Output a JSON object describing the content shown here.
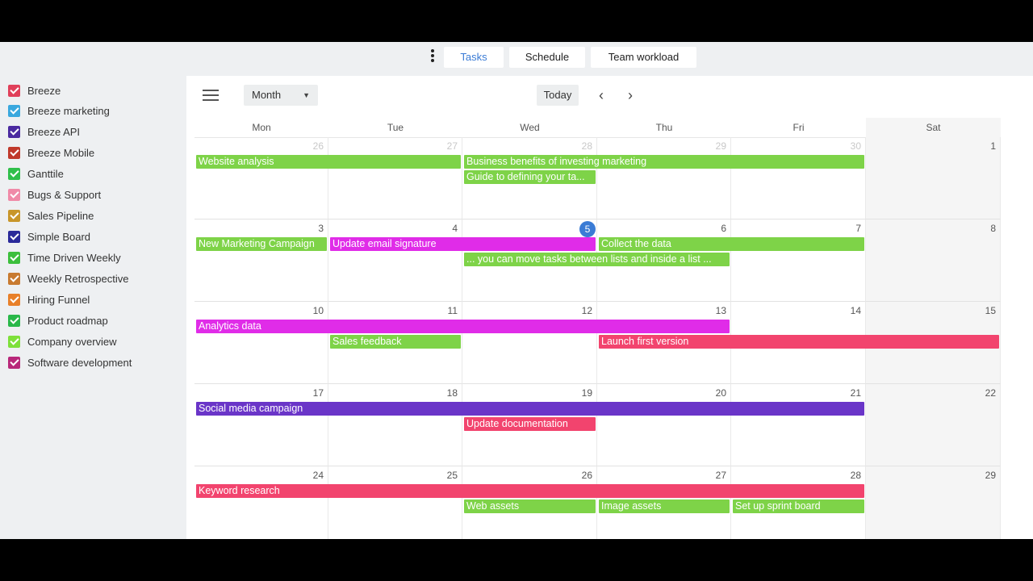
{
  "colors": {
    "green": "#7ed348",
    "magenta": "#e02ce8",
    "pink": "#f2446e",
    "purple": "#6a35c8",
    "accent": "#3a7bd5"
  },
  "topbar": {
    "menu_icon": "vertical-dots-icon",
    "tabs": [
      {
        "label": "Tasks",
        "active": true
      },
      {
        "label": "Schedule",
        "active": false
      },
      {
        "label": "Team workload",
        "active": false
      }
    ]
  },
  "sidebar": {
    "projects": [
      {
        "label": "Breeze",
        "color": "#e0405a"
      },
      {
        "label": "Breeze marketing",
        "color": "#3aa8de"
      },
      {
        "label": "Breeze API",
        "color": "#4a2aa0"
      },
      {
        "label": "Breeze Mobile",
        "color": "#c0392b"
      },
      {
        "label": "Ganttile",
        "color": "#2fbf4a"
      },
      {
        "label": "Bugs & Support",
        "color": "#f08aa8"
      },
      {
        "label": "Sales Pipeline",
        "color": "#c8962a"
      },
      {
        "label": "Simple Board",
        "color": "#2a2a9a"
      },
      {
        "label": "Time Driven Weekly",
        "color": "#3cbf3c"
      },
      {
        "label": "Weekly Retrospective",
        "color": "#c87a30"
      },
      {
        "label": "Hiring Funnel",
        "color": "#e8802a"
      },
      {
        "label": "Product roadmap",
        "color": "#2ab84a"
      },
      {
        "label": "Company overview",
        "color": "#7ee03a"
      },
      {
        "label": "Software development",
        "color": "#b8287a"
      }
    ]
  },
  "toolbar": {
    "menu_icon": "hamburger-icon",
    "view_select": "Month",
    "today_label": "Today",
    "prev_icon": "chevron-left-icon",
    "next_icon": "chevron-right-icon"
  },
  "calendar": {
    "weekdays": [
      "Mon",
      "Tue",
      "Wed",
      "Thu",
      "Fri",
      "Sat"
    ],
    "today": "5",
    "weeks": [
      {
        "days": [
          "26",
          "27",
          "28",
          "29",
          "30",
          "1"
        ],
        "dim": [
          true,
          true,
          true,
          true,
          true,
          false
        ]
      },
      {
        "days": [
          "3",
          "4",
          "5",
          "6",
          "7",
          "8"
        ],
        "dim": [
          false,
          false,
          false,
          false,
          false,
          false
        ]
      },
      {
        "days": [
          "10",
          "11",
          "12",
          "13",
          "14",
          "15"
        ],
        "dim": [
          false,
          false,
          false,
          false,
          false,
          false
        ]
      },
      {
        "days": [
          "17",
          "18",
          "19",
          "20",
          "21",
          "22"
        ],
        "dim": [
          false,
          false,
          false,
          false,
          false,
          false
        ]
      },
      {
        "days": [
          "24",
          "25",
          "26",
          "27",
          "28",
          "29"
        ],
        "dim": [
          false,
          false,
          false,
          false,
          false,
          false
        ]
      }
    ],
    "events": [
      {
        "title": "Website analysis",
        "week": 0,
        "start": 0,
        "end": 1,
        "lane": 0,
        "color": "green"
      },
      {
        "title": "Business benefits of investing marketing",
        "week": 0,
        "start": 2,
        "end": 4,
        "lane": 0,
        "color": "green"
      },
      {
        "title": "Guide to defining your ta...",
        "week": 0,
        "start": 2,
        "end": 2,
        "lane": 1,
        "color": "green"
      },
      {
        "title": "New Marketing Campaign",
        "week": 1,
        "start": 0,
        "end": 0,
        "lane": 0,
        "color": "green"
      },
      {
        "title": "Update email signature",
        "week": 1,
        "start": 1,
        "end": 2,
        "lane": 0,
        "color": "magenta"
      },
      {
        "title": "Collect the data",
        "week": 1,
        "start": 3,
        "end": 4,
        "lane": 0,
        "color": "green"
      },
      {
        "title": "... you can move tasks between lists and inside a list ...",
        "week": 1,
        "start": 2,
        "end": 3,
        "lane": 1,
        "color": "green"
      },
      {
        "title": "Analytics data",
        "week": 2,
        "start": 0,
        "end": 3,
        "lane": 0,
        "color": "magenta"
      },
      {
        "title": "Sales feedback",
        "week": 2,
        "start": 1,
        "end": 1,
        "lane": 1,
        "color": "green"
      },
      {
        "title": "Launch first version",
        "week": 2,
        "start": 3,
        "end": 5,
        "lane": 1,
        "color": "pink"
      },
      {
        "title": "Social media campaign",
        "week": 3,
        "start": 0,
        "end": 4,
        "lane": 0,
        "color": "purple"
      },
      {
        "title": "Update documentation",
        "week": 3,
        "start": 2,
        "end": 2,
        "lane": 1,
        "color": "pink"
      },
      {
        "title": "Keyword research",
        "week": 4,
        "start": 0,
        "end": 4,
        "lane": 0,
        "color": "pink"
      },
      {
        "title": "Web assets",
        "week": 4,
        "start": 2,
        "end": 2,
        "lane": 1,
        "color": "green"
      },
      {
        "title": "Image assets",
        "week": 4,
        "start": 3,
        "end": 3,
        "lane": 1,
        "color": "green"
      },
      {
        "title": "Set up sprint board",
        "week": 4,
        "start": 4,
        "end": 4,
        "lane": 1,
        "color": "green"
      }
    ]
  }
}
